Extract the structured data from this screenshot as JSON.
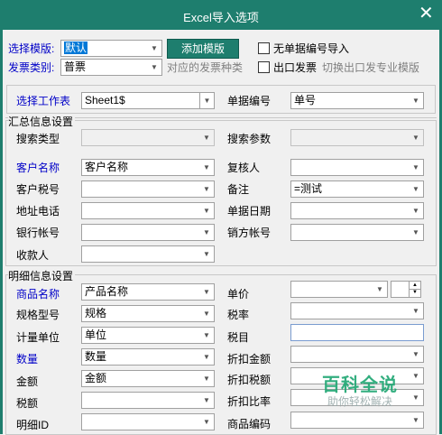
{
  "window": {
    "title": "Excel导入选项",
    "close_glyph": "✕"
  },
  "top": {
    "template_label": "选择模版:",
    "template_value": "默认",
    "add_template_button": "添加模版",
    "no_number_import_label": "无单据编号导入",
    "invoice_type_label": "发票类别:",
    "invoice_type_value": "普票",
    "corresponding_invoice_type": "对应的发票种类",
    "export_invoice_label": "出口发票",
    "switch_export_hint": "切换出口发专业模版"
  },
  "worksheet": {
    "label": "选择工作表",
    "value": "Sheet1$",
    "doc_number_label": "单据编号",
    "doc_number_value": "单号"
  },
  "summary": {
    "section_title": "汇总信息设置",
    "search_type_label": "搜索类型",
    "search_type_value": "",
    "search_param_label": "搜索参数",
    "search_param_value": "",
    "customer_name_label": "客户名称",
    "customer_name_value": "客户名称",
    "reviewer_label": "复核人",
    "reviewer_value": "",
    "customer_tax_label": "客户税号",
    "customer_tax_value": "",
    "remark_label": "备注",
    "remark_value": "=测试",
    "address_phone_label": "地址电话",
    "address_phone_value": "",
    "doc_date_label": "单据日期",
    "doc_date_value": "",
    "bank_account_label": "银行帐号",
    "bank_account_value": "",
    "seller_account_label": "销方帐号",
    "seller_account_value": "",
    "payee_label": "收款人",
    "payee_value": ""
  },
  "detail": {
    "section_title": "明细信息设置",
    "product_name_label": "商品名称",
    "product_name_value": "产品名称",
    "unit_price_label": "单价",
    "unit_price_value": "",
    "spec_label": "规格型号",
    "spec_value": "规格",
    "tax_rate_label": "税率",
    "tax_rate_value": "",
    "unit_label": "计量单位",
    "unit_value": "单位",
    "tax_item_label": "税目",
    "tax_item_value": "",
    "quantity_label": "数量",
    "quantity_value": "数量",
    "discount_amount_label": "折扣金额",
    "discount_amount_value": "",
    "amount_label": "金额",
    "amount_value": "金额",
    "discount_tax_label": "折扣税额",
    "discount_tax_value": "",
    "tax_amount_label": "税额",
    "tax_amount_value": "",
    "discount_rate_label": "折扣比率",
    "discount_rate_value": "",
    "detail_id_label": "明细ID",
    "detail_id_value": "",
    "product_code_label": "商品编码",
    "product_code_value": ""
  },
  "watermark": {
    "title": "百科全说",
    "subtitle": "助你轻松解决"
  },
  "colors": {
    "titlebar": "#1e7e6e",
    "accent_blue": "#0000c8"
  }
}
